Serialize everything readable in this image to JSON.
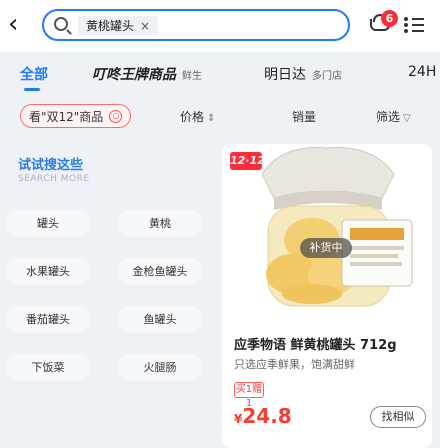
{
  "search": {
    "chip_text": "黄桃罐头",
    "chip_close": "×"
  },
  "cart": {
    "badge_count": "6"
  },
  "categories": [
    {
      "label": "全部",
      "sub": "",
      "active": true
    },
    {
      "label": "叮咚王牌商品",
      "sub": "鲜生",
      "active": false
    },
    {
      "label": "明日达",
      "sub": "多门店",
      "active": false
    },
    {
      "label": "24H",
      "sub": "",
      "active": false
    }
  ],
  "filters": {
    "pill_label": "看\"双12\"商品",
    "pill_icon": "○",
    "price_label": "价格",
    "price_arrow": "⇕",
    "sales_label": "销量",
    "filter_label": "筛选",
    "filter_arrow": "▽"
  },
  "left_panel": {
    "title": "试试搜这些",
    "subtitle": "SEARCH MORE",
    "keywords": [
      "罐头",
      "黄桃",
      "水果罐头",
      "金枪鱼罐头",
      "番茄罐头",
      "鱼罐头",
      "下饭菜",
      "火腿肠"
    ]
  },
  "product": {
    "promo_tag": "12·12",
    "restock_label": "补货中",
    "title": "应季物语 鲜黄桃罐头 712g",
    "description": "只选应季鲜果，饱满甜鲜",
    "badge": "买1赠1",
    "currency": "¥",
    "price": "24.8",
    "similar_button": "找相似"
  },
  "colors": {
    "accent": "#1e7bff",
    "price": "#ff3b30",
    "badge": "#ff2a3a"
  }
}
